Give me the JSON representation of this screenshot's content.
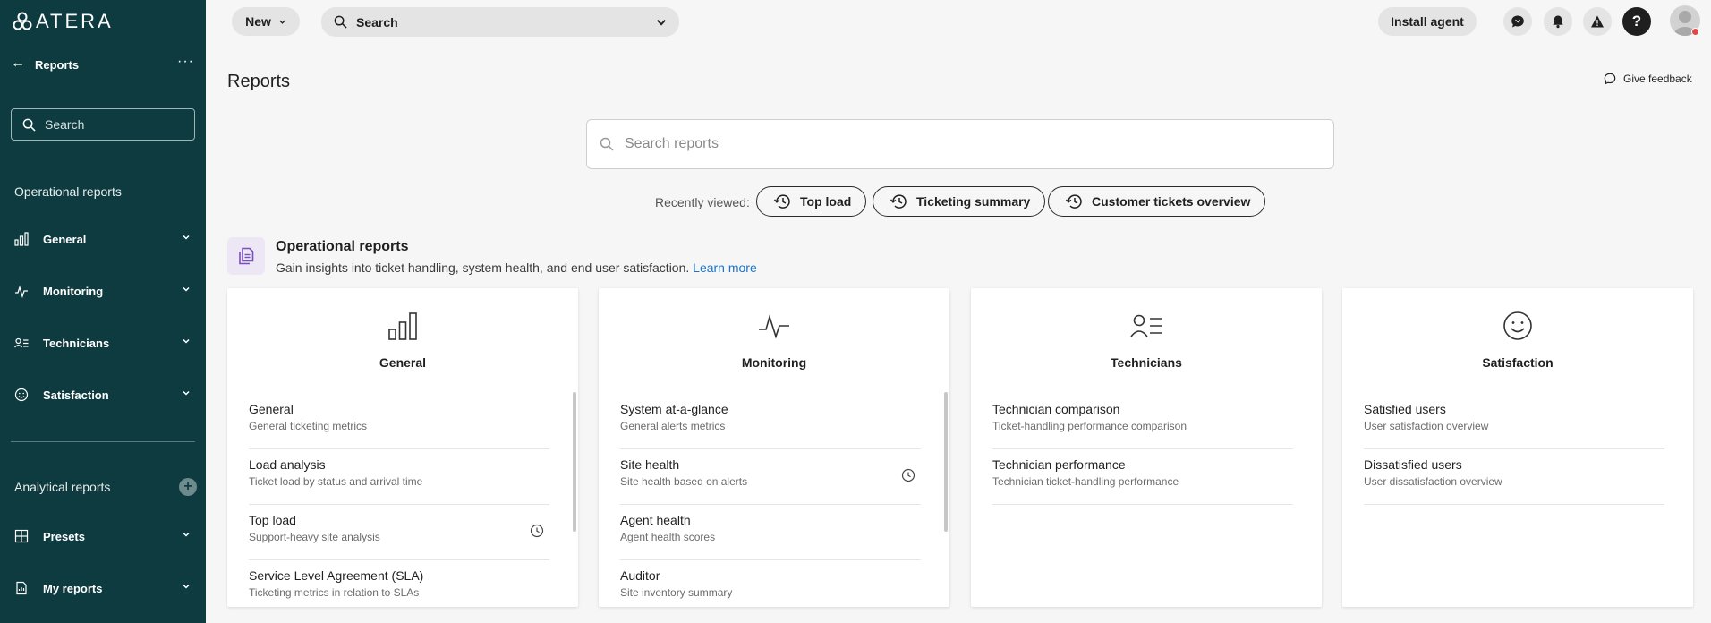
{
  "brand": {
    "name": "ATERA"
  },
  "sidebar": {
    "back_label": "Reports",
    "search_placeholder": "Search",
    "operational_heading": "Operational reports",
    "operational_items": [
      {
        "label": "General",
        "icon": "bar-chart-icon"
      },
      {
        "label": "Monitoring",
        "icon": "pulse-icon"
      },
      {
        "label": "Technicians",
        "icon": "technicians-icon"
      },
      {
        "label": "Satisfaction",
        "icon": "smiley-icon"
      }
    ],
    "analytical_heading": "Analytical reports",
    "analytical_items": [
      {
        "label": "Presets",
        "icon": "grid-icon"
      },
      {
        "label": "My reports",
        "icon": "report-icon"
      }
    ]
  },
  "topbar": {
    "new_label": "New",
    "search_placeholder": "Search",
    "install_label": "Install agent",
    "help_label": "?"
  },
  "page": {
    "title": "Reports",
    "feedback_label": "Give feedback",
    "search_placeholder": "Search reports",
    "recent_label": "Recently viewed:",
    "recent_items": [
      "Top load",
      "Ticketing summary",
      "Customer tickets overview"
    ]
  },
  "section": {
    "title": "Operational reports",
    "description": "Gain insights into ticket handling, system health, and end user satisfaction.",
    "learn_more": "Learn more"
  },
  "cards": [
    {
      "title": "General",
      "icon": "bar-chart-icon",
      "rows": [
        {
          "title": "General",
          "subtitle": "General ticketing metrics"
        },
        {
          "title": "Load analysis",
          "subtitle": "Ticket load by status and arrival time"
        },
        {
          "title": "Top load",
          "subtitle": "Support-heavy site analysis"
        },
        {
          "title": "Service Level Agreement (SLA)",
          "subtitle": "Ticketing metrics in relation to SLAs"
        }
      ]
    },
    {
      "title": "Monitoring",
      "icon": "pulse-icon",
      "rows": [
        {
          "title": "System at-a-glance",
          "subtitle": "General alerts metrics"
        },
        {
          "title": "Site health",
          "subtitle": "Site health based on alerts"
        },
        {
          "title": "Agent health",
          "subtitle": "Agent health scores"
        },
        {
          "title": "Auditor",
          "subtitle": "Site inventory summary"
        }
      ]
    },
    {
      "title": "Technicians",
      "icon": "technicians-icon",
      "rows": [
        {
          "title": "Technician comparison",
          "subtitle": "Ticket-handling performance comparison"
        },
        {
          "title": "Technician performance",
          "subtitle": "Technician ticket-handling performance"
        }
      ]
    },
    {
      "title": "Satisfaction",
      "icon": "smiley-icon",
      "rows": [
        {
          "title": "Satisfied users",
          "subtitle": "User satisfaction overview"
        },
        {
          "title": "Dissatisfied users",
          "subtitle": "User dissatisfaction overview"
        }
      ]
    }
  ]
}
